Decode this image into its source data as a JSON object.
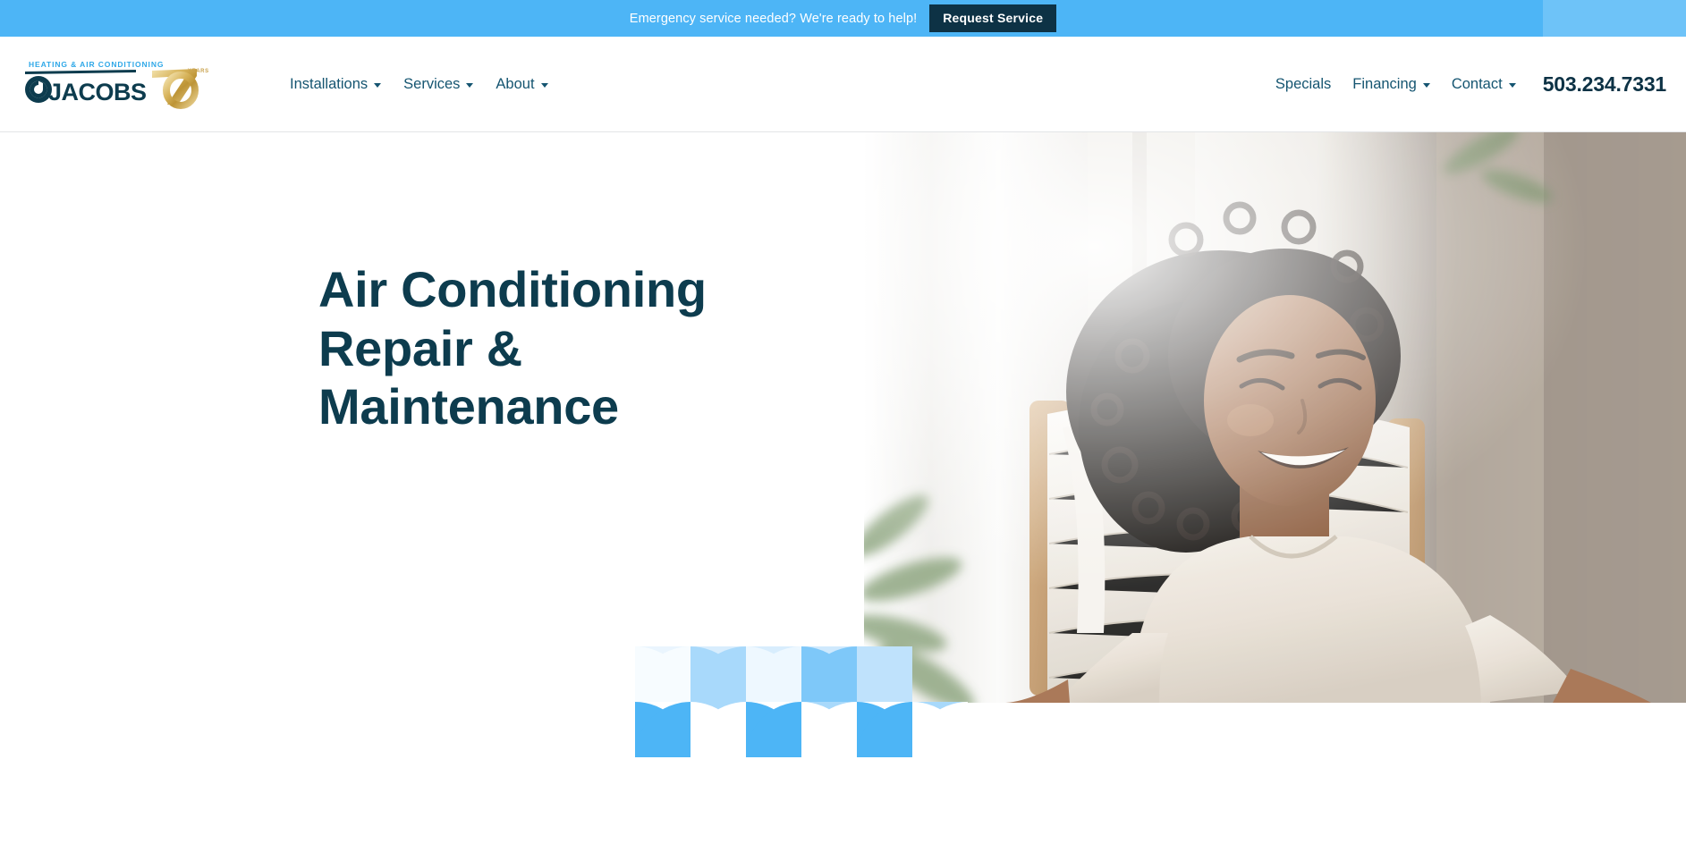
{
  "emergency_bar": {
    "message": "Emergency service needed? We're ready to help!",
    "cta_label": "Request Service",
    "background_color": "#4db5f6",
    "cta_background_color": "#0d3245",
    "text_color": "#ffffff"
  },
  "header": {
    "logo": {
      "tagline": "HEATING & AIR CONDITIONING",
      "wordmark": "JACOBS",
      "anniversary_number": "70",
      "anniversary_label": "YEARS",
      "wordmark_color": "#0d3c4e",
      "tagline_color": "#2fa8e8",
      "anniversary_color": "#d7b45a"
    },
    "nav_left": [
      {
        "label": "Installations",
        "has_dropdown": true
      },
      {
        "label": "Services",
        "has_dropdown": true
      },
      {
        "label": "About",
        "has_dropdown": true
      }
    ],
    "nav_right": [
      {
        "label": "Specials",
        "has_dropdown": false
      },
      {
        "label": "Financing",
        "has_dropdown": true
      },
      {
        "label": "Contact",
        "has_dropdown": true
      }
    ],
    "phone": "503.234.7331",
    "link_color": "#155571"
  },
  "hero": {
    "title": "Air Conditioning Repair & Maintenance",
    "title_color": "#0d3c4e",
    "image_alt": "Smiling woman relaxing in a wooden rocking chair in a bright living room",
    "pattern": {
      "name": "leaf-grid-pattern",
      "rows": 2,
      "columns": 6,
      "colors": [
        "#f2f9fe",
        "#d4ecfd",
        "#a6d8fb",
        "#4db5f6"
      ]
    }
  }
}
